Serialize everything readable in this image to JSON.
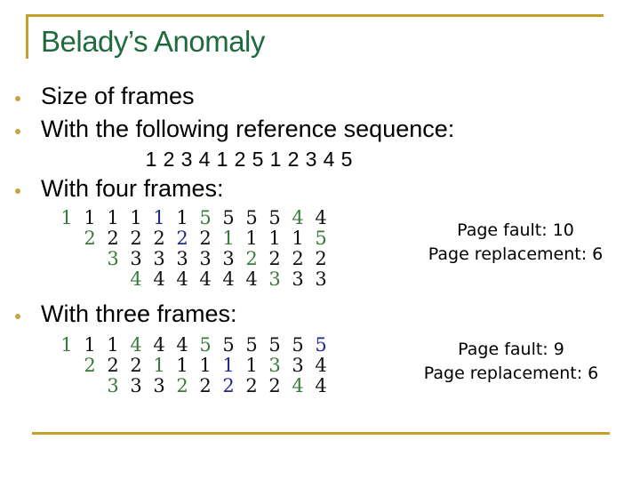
{
  "title": "Belady’s Anomaly",
  "bullets": {
    "b1": "Size of frames",
    "b2": "With the following reference sequence:",
    "b3": "With four frames:",
    "b4": "With three frames:"
  },
  "reference_sequence": [
    "1",
    "2",
    "3",
    "4",
    "1",
    "2",
    "5",
    "1",
    "2",
    "3",
    "4",
    "5"
  ],
  "four_frames": {
    "columns": [
      [
        {
          "v": "1",
          "c": "green"
        }
      ],
      [
        {
          "v": "1",
          "c": "black"
        },
        {
          "v": "2",
          "c": "green"
        }
      ],
      [
        {
          "v": "1",
          "c": "black"
        },
        {
          "v": "2",
          "c": "black"
        },
        {
          "v": "3",
          "c": "green"
        }
      ],
      [
        {
          "v": "1",
          "c": "black"
        },
        {
          "v": "2",
          "c": "black"
        },
        {
          "v": "3",
          "c": "black"
        },
        {
          "v": "4",
          "c": "green"
        }
      ],
      [
        {
          "v": "1",
          "c": "blue"
        },
        {
          "v": "2",
          "c": "black"
        },
        {
          "v": "3",
          "c": "black"
        },
        {
          "v": "4",
          "c": "black"
        }
      ],
      [
        {
          "v": "1",
          "c": "black"
        },
        {
          "v": "2",
          "c": "blue"
        },
        {
          "v": "3",
          "c": "black"
        },
        {
          "v": "4",
          "c": "black"
        }
      ],
      [
        {
          "v": "5",
          "c": "green"
        },
        {
          "v": "2",
          "c": "black"
        },
        {
          "v": "3",
          "c": "black"
        },
        {
          "v": "4",
          "c": "black"
        }
      ],
      [
        {
          "v": "5",
          "c": "black"
        },
        {
          "v": "1",
          "c": "green"
        },
        {
          "v": "3",
          "c": "black"
        },
        {
          "v": "4",
          "c": "black"
        }
      ],
      [
        {
          "v": "5",
          "c": "black"
        },
        {
          "v": "1",
          "c": "black"
        },
        {
          "v": "2",
          "c": "green"
        },
        {
          "v": "4",
          "c": "black"
        }
      ],
      [
        {
          "v": "5",
          "c": "black"
        },
        {
          "v": "1",
          "c": "black"
        },
        {
          "v": "2",
          "c": "black"
        },
        {
          "v": "3",
          "c": "green"
        }
      ],
      [
        {
          "v": "4",
          "c": "green"
        },
        {
          "v": "1",
          "c": "black"
        },
        {
          "v": "2",
          "c": "black"
        },
        {
          "v": "3",
          "c": "black"
        }
      ],
      [
        {
          "v": "4",
          "c": "black"
        },
        {
          "v": "5",
          "c": "green"
        },
        {
          "v": "2",
          "c": "black"
        },
        {
          "v": "3",
          "c": "black"
        }
      ]
    ],
    "page_fault": "Page fault: 10",
    "page_replacement": "Page replacement: 6"
  },
  "three_frames": {
    "columns": [
      [
        {
          "v": "1",
          "c": "green"
        }
      ],
      [
        {
          "v": "1",
          "c": "black"
        },
        {
          "v": "2",
          "c": "green"
        }
      ],
      [
        {
          "v": "1",
          "c": "black"
        },
        {
          "v": "2",
          "c": "black"
        },
        {
          "v": "3",
          "c": "green"
        }
      ],
      [
        {
          "v": "4",
          "c": "green"
        },
        {
          "v": "2",
          "c": "black"
        },
        {
          "v": "3",
          "c": "black"
        }
      ],
      [
        {
          "v": "4",
          "c": "black"
        },
        {
          "v": "1",
          "c": "green"
        },
        {
          "v": "3",
          "c": "black"
        }
      ],
      [
        {
          "v": "4",
          "c": "black"
        },
        {
          "v": "1",
          "c": "black"
        },
        {
          "v": "2",
          "c": "green"
        }
      ],
      [
        {
          "v": "5",
          "c": "green"
        },
        {
          "v": "1",
          "c": "black"
        },
        {
          "v": "2",
          "c": "black"
        }
      ],
      [
        {
          "v": "5",
          "c": "black"
        },
        {
          "v": "1",
          "c": "blue"
        },
        {
          "v": "2",
          "c": "blue"
        }
      ],
      [
        {
          "v": "5",
          "c": "black"
        },
        {
          "v": "1",
          "c": "black"
        },
        {
          "v": "2",
          "c": "black"
        }
      ],
      [
        {
          "v": "5",
          "c": "black"
        },
        {
          "v": "3",
          "c": "green"
        },
        {
          "v": "2",
          "c": "black"
        }
      ],
      [
        {
          "v": "5",
          "c": "black"
        },
        {
          "v": "3",
          "c": "black"
        },
        {
          "v": "4",
          "c": "green"
        }
      ],
      [
        {
          "v": "5",
          "c": "blue"
        },
        {
          "v": "4",
          "c": "black"
        },
        {
          "v": "4",
          "c": "black"
        }
      ]
    ],
    "page_fault": "Page fault: 9",
    "page_replacement": "Page replacement: 6"
  },
  "colors": {
    "title": "#1f6b3d",
    "rule": "#c4a02a",
    "green": "#3a7a3a",
    "blue": "#1f2a8a",
    "black": "#111111"
  }
}
